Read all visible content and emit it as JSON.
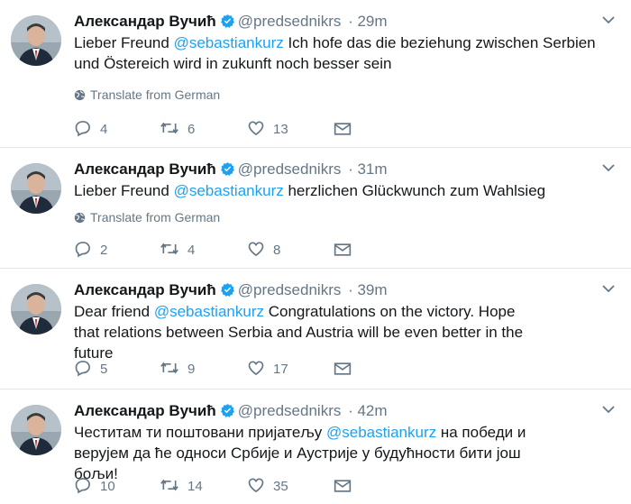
{
  "tweets": [
    {
      "name": "Александар Вучић",
      "handle": "@predsednikrs",
      "time": "· 29m",
      "text_before": "Lieber Freund ",
      "mention": "@sebastiankurz",
      "text_after": "  Ich hofe das die beziehung zwischen Serbien und Östereich wird in zukunft noch besser sein",
      "translate": "Translate from German",
      "replies": "4",
      "retweets": "6",
      "likes": "13"
    },
    {
      "name": "Александар Вучић",
      "handle": "@predsednikrs",
      "time": "· 31m",
      "text_before": "Lieber Freund ",
      "mention": "@sebastiankurz",
      "text_after": " herzlichen Glückwunch zum Wahlsieg",
      "translate": "Translate from German",
      "replies": "2",
      "retweets": "4",
      "likes": "8"
    },
    {
      "name": "Александар Вучић",
      "handle": "@predsednikrs",
      "time": "· 39m",
      "text_before": "Dear friend ",
      "mention": "@sebastiankurz",
      "text_after": " Congratulations on the victory. Hope that relations between Serbia and Austria will be even better in the future",
      "replies": "5",
      "retweets": "9",
      "likes": "17"
    },
    {
      "name": "Александар Вучић",
      "handle": "@predsednikrs",
      "time": "· 42m",
      "text_before": "Честитам ти поштовани пријатељу ",
      "mention": "@sebastiankurz",
      "text_after": " на победи и верујем да ће односи Србије и Аустрије у  будућности бити још бољи!",
      "replies": "10",
      "retweets": "14",
      "likes": "35"
    }
  ],
  "colors": {
    "accent": "#1da1f2",
    "muted": "#657786",
    "text": "#14171a",
    "divider": "#e1e8ed"
  },
  "icons": {
    "verified": "verified-badge-icon",
    "caret": "chevron-down-icon",
    "globe": "globe-icon",
    "reply": "reply-icon",
    "retweet": "retweet-icon",
    "like": "heart-icon",
    "dm": "envelope-icon"
  }
}
